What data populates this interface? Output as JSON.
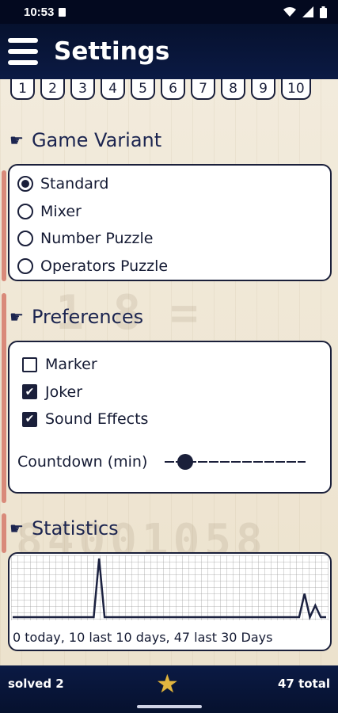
{
  "status_bar": {
    "time": "10:53"
  },
  "app_bar": {
    "title": "Settings"
  },
  "number_tabs": [
    "1",
    "2",
    "3",
    "4",
    "5",
    "6",
    "7",
    "8",
    "9",
    "10"
  ],
  "game_variant": {
    "heading": "Game Variant",
    "options": [
      {
        "label": "Standard",
        "selected": true
      },
      {
        "label": "Mixer",
        "selected": false
      },
      {
        "label": "Number Puzzle",
        "selected": false
      },
      {
        "label": "Operators Puzzle",
        "selected": false
      }
    ]
  },
  "preferences": {
    "heading": "Preferences",
    "checks": [
      {
        "label": "Marker",
        "checked": false
      },
      {
        "label": "Joker",
        "checked": true
      },
      {
        "label": "Sound Effects",
        "checked": true
      }
    ],
    "countdown_label": "Countdown (min)",
    "countdown_fraction": 0.1
  },
  "statistics": {
    "heading": "Statistics",
    "summary": "0 today, 10 last 10 days, 47 last 30 Days",
    "chart_data": {
      "type": "line",
      "series": [
        {
          "values": [
            0,
            0,
            0,
            0,
            0,
            0,
            0,
            0,
            0,
            0,
            0,
            0,
            0,
            0,
            0,
            0,
            10,
            0,
            0,
            0,
            0,
            0,
            0,
            0,
            0,
            0,
            0,
            0,
            0,
            0,
            0,
            0,
            0,
            0,
            0,
            0,
            0,
            0,
            0,
            0,
            0,
            0,
            0,
            0,
            0,
            0,
            0,
            0,
            0,
            0,
            0,
            0,
            0,
            0,
            4,
            0,
            2,
            0,
            0
          ]
        }
      ]
    }
  },
  "bottom_bar": {
    "solved": "solved 2",
    "total": "47 total"
  },
  "colors": {
    "navy": "#0b1a44",
    "star": "#e2b640",
    "accent": "#d98a7a"
  }
}
